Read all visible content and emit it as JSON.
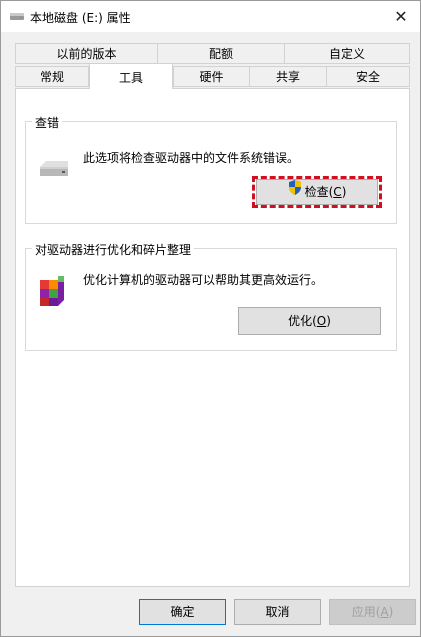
{
  "window": {
    "title": "本地磁盘 (E:) 属性",
    "close_glyph": "✕"
  },
  "tabs_row1": [
    {
      "label": "以前的版本"
    },
    {
      "label": "配额"
    },
    {
      "label": "自定义"
    }
  ],
  "tabs_row2": [
    {
      "label": "常规"
    },
    {
      "label": "工具",
      "active": true
    },
    {
      "label": "硬件"
    },
    {
      "label": "共享"
    },
    {
      "label": "安全"
    }
  ],
  "error_check": {
    "title": "查错",
    "description": "此选项将检查驱动器中的文件系统错误。",
    "button_label_main": "检查(",
    "button_accel": "C",
    "button_label_end": ")"
  },
  "optimize": {
    "title": "对驱动器进行优化和碎片整理",
    "description": "优化计算机的驱动器可以帮助其更高效运行。",
    "button_label_main": "优化(",
    "button_accel": "O",
    "button_label_end": ")"
  },
  "footer": {
    "ok_label": "确定",
    "cancel_label": "取消",
    "apply_main": "应用(",
    "apply_accel": "A",
    "apply_end": ")"
  },
  "colors": {
    "highlight": "#d10f1f",
    "accent": "#0078d7"
  },
  "icons": {
    "drive": "drive-icon",
    "shield": "uac-shield-icon",
    "defrag": "defrag-icon"
  }
}
